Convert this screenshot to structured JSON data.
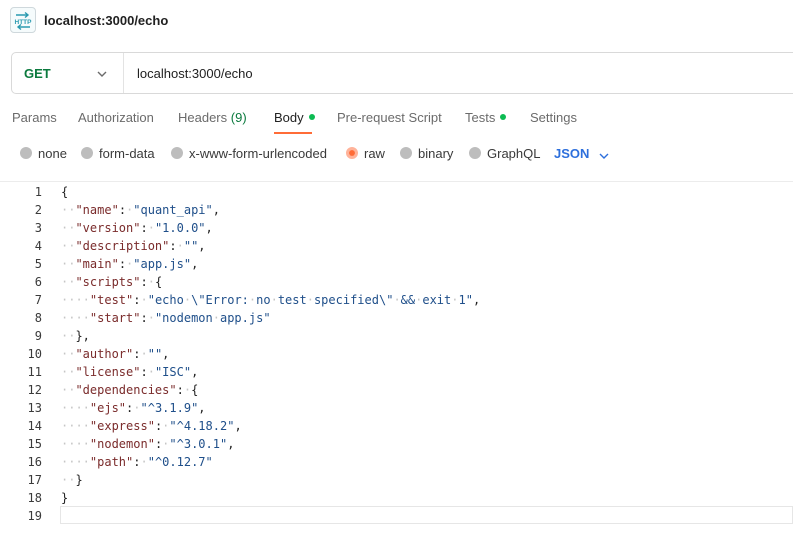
{
  "header": {
    "icon_text": "HTTP",
    "title": "localhost:3000/echo"
  },
  "request": {
    "method": "GET",
    "url": "localhost:3000/echo"
  },
  "tabs": [
    {
      "label": "Params"
    },
    {
      "label": "Authorization"
    },
    {
      "label": "Headers",
      "count": "(9)"
    },
    {
      "label": "Body",
      "active": true,
      "has_dot": true
    },
    {
      "label": "Pre-request Script"
    },
    {
      "label": "Tests",
      "has_dot": true
    },
    {
      "label": "Settings"
    }
  ],
  "body_types": [
    {
      "label": "none"
    },
    {
      "label": "form-data"
    },
    {
      "label": "x-www-form-urlencoded"
    },
    {
      "label": "raw",
      "selected": true
    },
    {
      "label": "binary"
    },
    {
      "label": "GraphQL"
    }
  ],
  "format": "JSON",
  "editor": {
    "line_numbers": [
      "1",
      "2",
      "3",
      "4",
      "5",
      "6",
      "7",
      "8",
      "9",
      "10",
      "11",
      "12",
      "13",
      "14",
      "15",
      "16",
      "17",
      "18",
      "19"
    ],
    "lines": [
      "{",
      "  \"name\": \"quant_api\",",
      "  \"version\": \"1.0.0\",",
      "  \"description\": \"\",",
      "  \"main\": \"app.js\",",
      "  \"scripts\": {",
      "    \"test\": \"echo \\\"Error: no test specified\\\" && exit 1\",",
      "    \"start\": \"nodemon app.js\"",
      "  },",
      "  \"author\": \"\",",
      "  \"license\": \"ISC\",",
      "  \"dependencies\": {",
      "    \"ejs\": \"^3.1.9\",",
      "    \"express\": \"^4.18.2\",",
      "    \"nodemon\": \"^3.0.1\",",
      "    \"path\": \"^0.12.7\"",
      "  }",
      "}",
      ""
    ]
  },
  "colors": {
    "accent_orange": "#ff6c37",
    "get_green": "#0b7a3e",
    "dot_green": "#0cbb52",
    "format_blue": "#2d6fdc"
  }
}
